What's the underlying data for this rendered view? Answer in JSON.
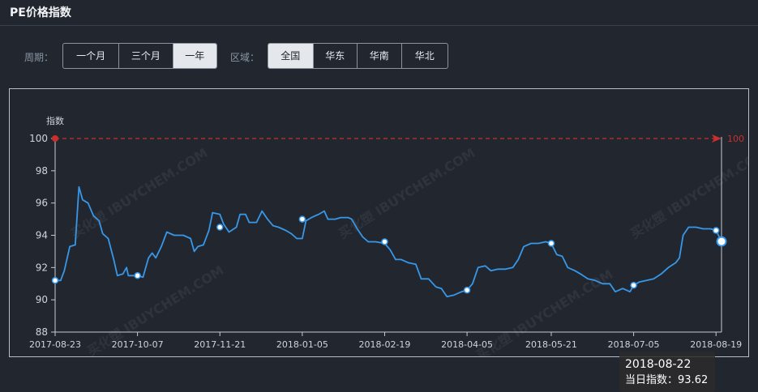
{
  "header": {
    "title": "PE价格指数"
  },
  "filters": {
    "period_label": "周期：",
    "period_options": [
      "一个月",
      "三个月",
      "一年"
    ],
    "period_selected": "一年",
    "region_label": "区域：",
    "region_options": [
      "全国",
      "华东",
      "华南",
      "华北"
    ],
    "region_selected": "全国"
  },
  "watermark": "买化塑 IBUYCHEM.COM",
  "tooltip": {
    "date": "2018-08-22",
    "label": "当日指数：",
    "value": "93.62"
  },
  "chart_data": {
    "type": "line",
    "ylabel": "指数",
    "ylim": [
      88,
      100
    ],
    "yticks": [
      88,
      90,
      92,
      94,
      96,
      98,
      100
    ],
    "xlim": [
      "2017-08-23",
      "2018-08-22"
    ],
    "xticks": [
      "2017-08-23",
      "2017-10-07",
      "2017-11-21",
      "2018-01-05",
      "2018-02-19",
      "2018-04-05",
      "2018-05-21",
      "2018-07-05",
      "2018-08-19"
    ],
    "grid": false,
    "series": [
      {
        "color": "#3797e8",
        "points": [
          [
            "2017-08-23",
            91.2
          ],
          [
            "2017-08-26",
            91.2
          ],
          [
            "2017-08-28",
            91.8
          ],
          [
            "2017-08-31",
            93.3
          ],
          [
            "2017-09-03",
            93.4
          ],
          [
            "2017-09-05",
            97.0
          ],
          [
            "2017-09-07",
            96.2
          ],
          [
            "2017-09-10",
            96.0
          ],
          [
            "2017-09-13",
            95.2
          ],
          [
            "2017-09-16",
            94.9
          ],
          [
            "2017-09-18",
            94.1
          ],
          [
            "2017-09-21",
            93.8
          ],
          [
            "2017-09-24",
            92.5
          ],
          [
            "2017-09-26",
            91.5
          ],
          [
            "2017-09-29",
            91.6
          ],
          [
            "2017-10-01",
            92.0
          ],
          [
            "2017-10-02",
            91.5
          ],
          [
            "2017-10-07",
            91.5
          ],
          [
            "2017-10-10",
            91.4
          ],
          [
            "2017-10-13",
            92.6
          ],
          [
            "2017-10-15",
            92.9
          ],
          [
            "2017-10-17",
            92.6
          ],
          [
            "2017-10-20",
            93.3
          ],
          [
            "2017-10-23",
            94.2
          ],
          [
            "2017-10-27",
            94.0
          ],
          [
            "2017-11-01",
            94.0
          ],
          [
            "2017-11-05",
            93.8
          ],
          [
            "2017-11-07",
            93.0
          ],
          [
            "2017-11-09",
            93.3
          ],
          [
            "2017-11-12",
            93.4
          ],
          [
            "2017-11-15",
            94.3
          ],
          [
            "2017-11-17",
            95.4
          ],
          [
            "2017-11-21",
            95.3
          ],
          [
            "2017-11-23",
            94.7
          ],
          [
            "2017-11-26",
            94.2
          ],
          [
            "2017-11-30",
            94.5
          ],
          [
            "2017-12-02",
            95.3
          ],
          [
            "2017-12-05",
            95.3
          ],
          [
            "2017-12-07",
            94.8
          ],
          [
            "2017-12-11",
            94.8
          ],
          [
            "2017-12-14",
            95.5
          ],
          [
            "2017-12-17",
            95.0
          ],
          [
            "2017-12-20",
            94.6
          ],
          [
            "2017-12-23",
            94.5
          ],
          [
            "2017-12-27",
            94.3
          ],
          [
            "2017-12-30",
            94.1
          ],
          [
            "2018-01-02",
            93.8
          ],
          [
            "2018-01-05",
            93.8
          ],
          [
            "2018-01-07",
            94.9
          ],
          [
            "2018-01-10",
            95.1
          ],
          [
            "2018-01-14",
            95.3
          ],
          [
            "2018-01-17",
            95.5
          ],
          [
            "2018-01-19",
            95.0
          ],
          [
            "2018-01-23",
            95.0
          ],
          [
            "2018-01-26",
            95.1
          ],
          [
            "2018-01-30",
            95.1
          ],
          [
            "2018-02-01",
            95.0
          ],
          [
            "2018-02-04",
            94.4
          ],
          [
            "2018-02-07",
            93.9
          ],
          [
            "2018-02-10",
            93.6
          ],
          [
            "2018-02-14",
            93.6
          ],
          [
            "2018-02-19",
            93.5
          ],
          [
            "2018-02-22",
            93.1
          ],
          [
            "2018-02-25",
            92.5
          ],
          [
            "2018-02-28",
            92.5
          ],
          [
            "2018-03-04",
            92.3
          ],
          [
            "2018-03-08",
            92.2
          ],
          [
            "2018-03-11",
            91.3
          ],
          [
            "2018-03-15",
            91.3
          ],
          [
            "2018-03-19",
            90.8
          ],
          [
            "2018-03-22",
            90.7
          ],
          [
            "2018-03-25",
            90.2
          ],
          [
            "2018-03-29",
            90.3
          ],
          [
            "2018-04-02",
            90.5
          ],
          [
            "2018-04-05",
            90.6
          ],
          [
            "2018-04-08",
            91.0
          ],
          [
            "2018-04-11",
            92.0
          ],
          [
            "2018-04-15",
            92.1
          ],
          [
            "2018-04-18",
            91.8
          ],
          [
            "2018-04-22",
            91.9
          ],
          [
            "2018-04-26",
            91.9
          ],
          [
            "2018-04-30",
            92.0
          ],
          [
            "2018-05-03",
            92.5
          ],
          [
            "2018-05-06",
            93.3
          ],
          [
            "2018-05-10",
            93.5
          ],
          [
            "2018-05-14",
            93.5
          ],
          [
            "2018-05-18",
            93.6
          ],
          [
            "2018-05-21",
            93.5
          ],
          [
            "2018-05-24",
            92.8
          ],
          [
            "2018-05-27",
            92.7
          ],
          [
            "2018-05-30",
            92.0
          ],
          [
            "2018-06-03",
            91.8
          ],
          [
            "2018-06-06",
            91.6
          ],
          [
            "2018-06-10",
            91.3
          ],
          [
            "2018-06-14",
            91.2
          ],
          [
            "2018-06-18",
            91.0
          ],
          [
            "2018-06-22",
            91.0
          ],
          [
            "2018-06-25",
            90.5
          ],
          [
            "2018-06-29",
            90.7
          ],
          [
            "2018-07-03",
            90.5
          ],
          [
            "2018-07-05",
            90.9
          ],
          [
            "2018-07-08",
            91.1
          ],
          [
            "2018-07-12",
            91.2
          ],
          [
            "2018-07-16",
            91.3
          ],
          [
            "2018-07-20",
            91.6
          ],
          [
            "2018-07-24",
            92.0
          ],
          [
            "2018-07-28",
            92.3
          ],
          [
            "2018-07-30",
            92.6
          ],
          [
            "2018-08-01",
            94.0
          ],
          [
            "2018-08-04",
            94.5
          ],
          [
            "2018-08-08",
            94.5
          ],
          [
            "2018-08-12",
            94.4
          ],
          [
            "2018-08-16",
            94.4
          ],
          [
            "2018-08-19",
            94.3
          ],
          [
            "2018-08-22",
            93.62
          ]
        ],
        "markers": [
          [
            "2017-08-23",
            91.2
          ],
          [
            "2017-10-07",
            91.5
          ],
          [
            "2017-11-21",
            94.5
          ],
          [
            "2018-01-05",
            95.0
          ],
          [
            "2018-02-19",
            93.6
          ],
          [
            "2018-04-05",
            90.6
          ],
          [
            "2018-05-21",
            93.5
          ],
          [
            "2018-07-05",
            90.9
          ],
          [
            "2018-08-19",
            94.3
          ]
        ],
        "highlight": [
          "2018-08-22",
          93.62
        ]
      }
    ],
    "reference_line": {
      "value": 100,
      "label": "100",
      "color": "#c9302c"
    }
  }
}
